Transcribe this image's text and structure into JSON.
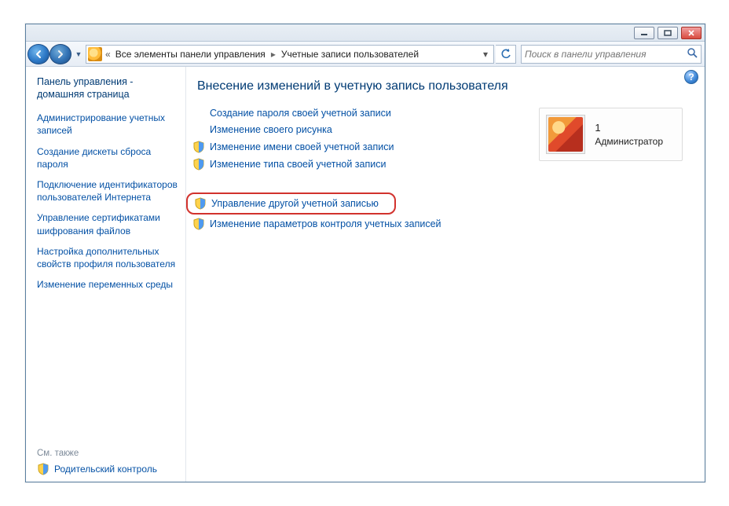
{
  "titlebar": {
    "min": "–",
    "max": "❐",
    "close": "✕"
  },
  "nav": {
    "breadcrumb_prefix": "«",
    "crumb1": "Все элементы панели управления",
    "crumb2": "Учетные записи пользователей",
    "search_placeholder": "Поиск в панели управления"
  },
  "sidebar": {
    "home": "Панель управления - домашняя страница",
    "tasks": [
      "Администрирование учетных записей",
      "Создание дискеты сброса пароля",
      "Подключение идентификаторов пользователей Интернета",
      "Управление сертификатами шифрования файлов",
      "Настройка дополнительных свойств профиля пользователя",
      "Изменение переменных среды"
    ],
    "see_also_label": "См. также",
    "see_also_link": "Родительский контроль"
  },
  "main": {
    "heading": "Внесение изменений в учетную запись пользователя",
    "actions": [
      {
        "label": "Создание пароля своей учетной записи",
        "shield": false
      },
      {
        "label": "Изменение своего рисунка",
        "shield": false
      },
      {
        "label": "Изменение имени своей учетной записи",
        "shield": true
      },
      {
        "label": "Изменение типа своей учетной записи",
        "shield": true
      }
    ],
    "actions2": [
      {
        "label": "Управление другой учетной записью",
        "shield": true,
        "highlight": true
      },
      {
        "label": "Изменение параметров контроля учетных записей",
        "shield": true
      }
    ],
    "user": {
      "name": "1",
      "role": "Администратор"
    }
  }
}
